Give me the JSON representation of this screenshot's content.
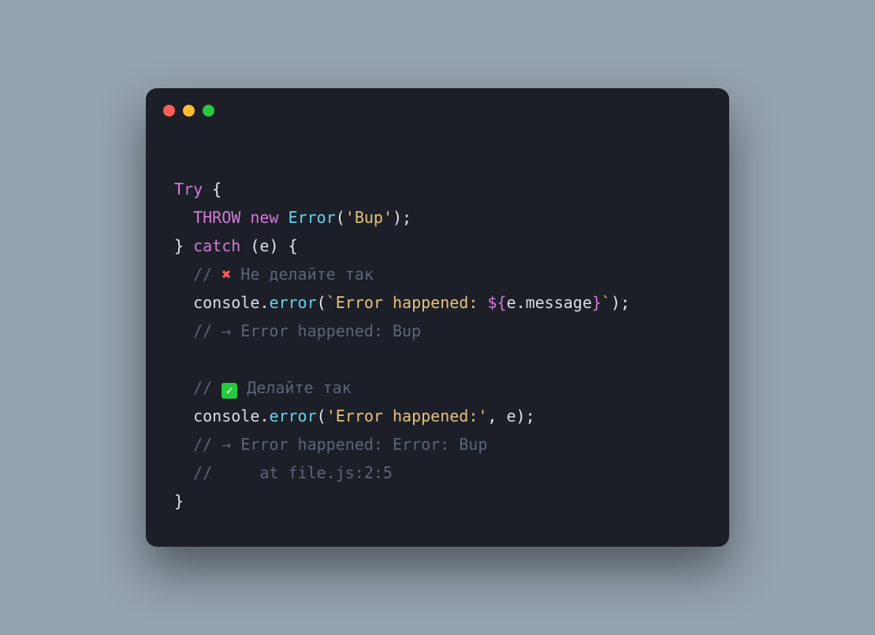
{
  "window": {
    "dots": {
      "red": "#ff5f56",
      "yellow": "#ffbd2e",
      "green": "#27c93f"
    }
  },
  "code": {
    "l1": {
      "try": "Try",
      "brace": " {"
    },
    "l2": {
      "throw": "THROW",
      "new": " new",
      "error": " Error",
      "open": "(",
      "str": "'Bup'",
      "close": ");"
    },
    "l3": {
      "brace": "}",
      "catch": " catch",
      "open": " (",
      "e": "e",
      "close": ") {"
    },
    "l4": {
      "slashes": "// ",
      "x": "✖",
      "rest": " Не делайте так"
    },
    "l5": {
      "console": "console",
      "dot": ".",
      "error": "error",
      "open": "(",
      "tick1": "`",
      "str1": "Error happened: ",
      "iopn": "${",
      "expr": "e.message",
      "icls": "}",
      "tick2": "`",
      "close": ");"
    },
    "l6": {
      "text": "// → Error happened: Bup"
    },
    "l7": {
      "slashes": "// ",
      "check": "✓",
      "rest": " Делайте так"
    },
    "l8": {
      "console": "console",
      "dot": ".",
      "error": "error",
      "open": "(",
      "str": "'Error happened:'",
      "comma": ", ",
      "e": "e",
      "close": ");"
    },
    "l9": {
      "text": "// → Error happened: Error: Bup"
    },
    "l10": {
      "text": "//     at file.js:2:5"
    },
    "l11": {
      "brace": "}"
    }
  }
}
